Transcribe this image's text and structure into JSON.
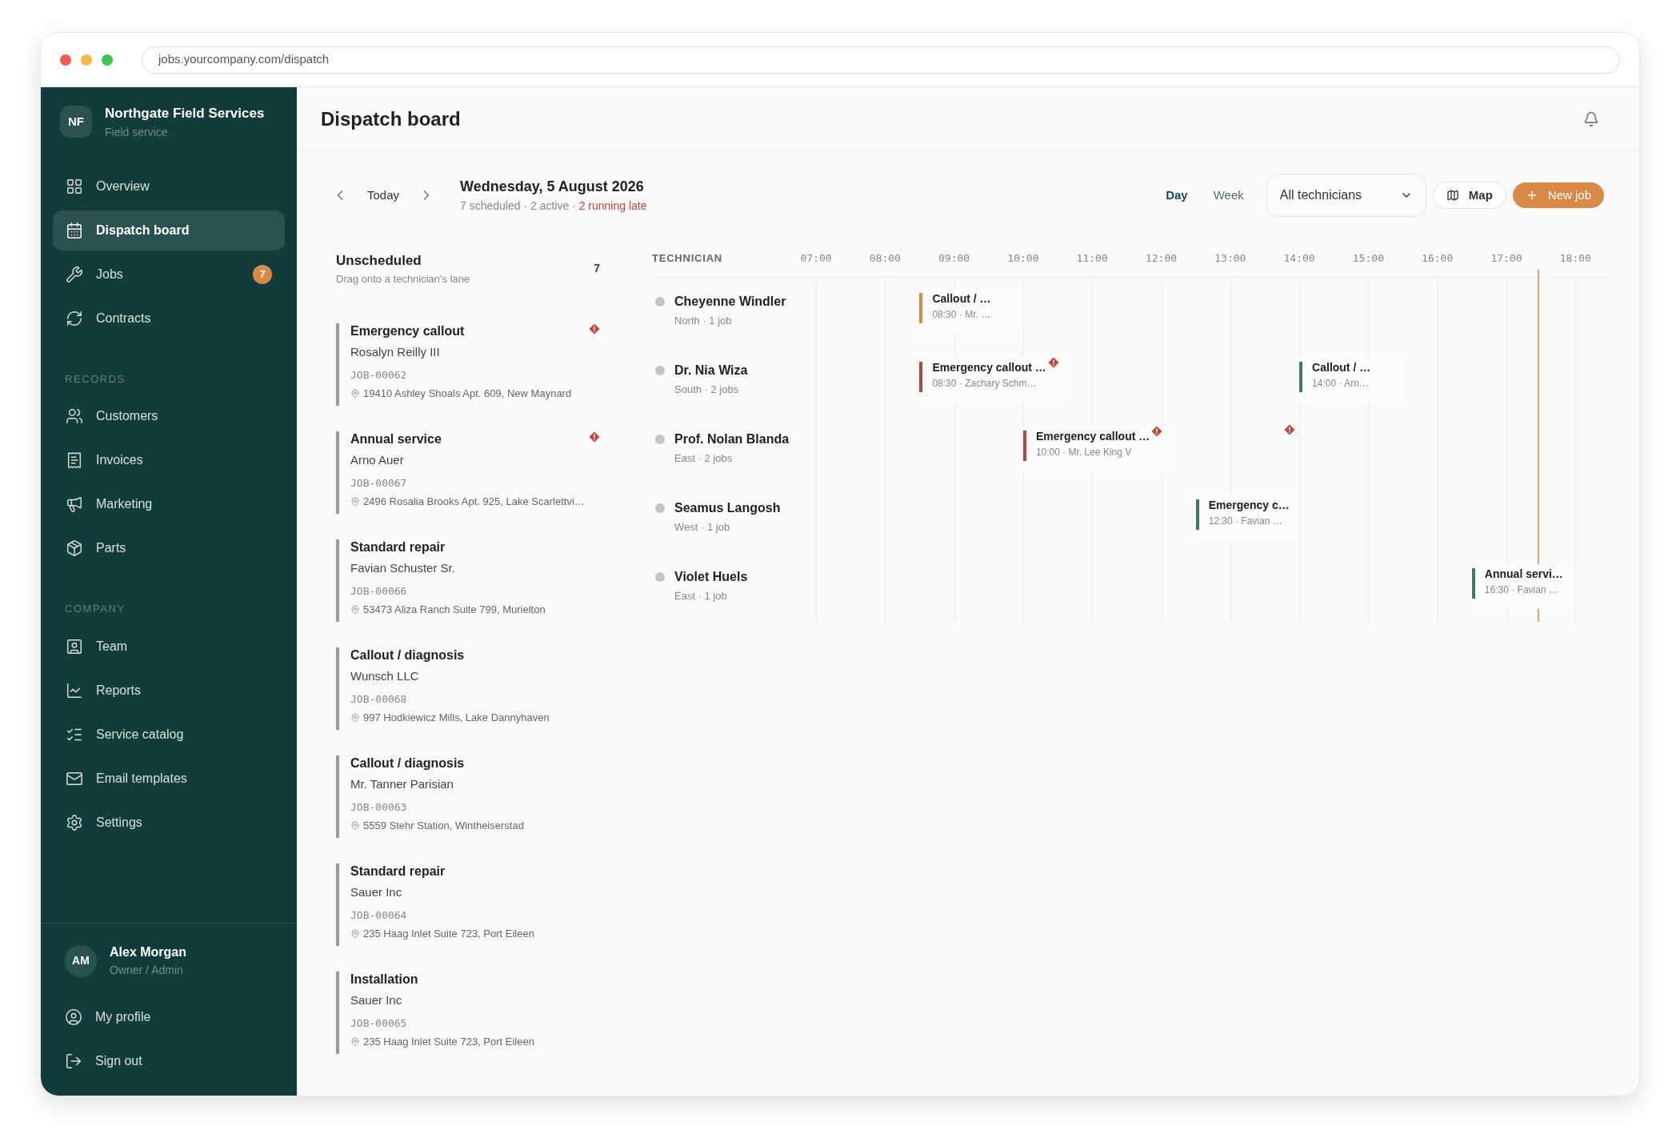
{
  "browser": {
    "url": "jobs.yourcompany.com/dispatch"
  },
  "sidebar": {
    "brand": {
      "initials": "NF",
      "name": "Northgate Field Services",
      "subtitle": "Field service"
    },
    "sections": [
      {
        "items": [
          {
            "label": "Overview",
            "selected": false
          },
          {
            "label": "Dispatch board",
            "selected": true
          },
          {
            "label": "Jobs",
            "selected": false,
            "badge": "7"
          },
          {
            "label": "Contracts",
            "selected": false
          }
        ]
      },
      {
        "heading": "RECORDS",
        "items": [
          {
            "label": "Customers",
            "selected": false
          },
          {
            "label": "Invoices",
            "selected": false
          },
          {
            "label": "Marketing",
            "selected": false
          },
          {
            "label": "Parts",
            "selected": false
          }
        ]
      },
      {
        "heading": "COMPANY",
        "items": [
          {
            "label": "Team",
            "selected": false
          },
          {
            "label": "Reports",
            "selected": false
          },
          {
            "label": "Service catalog",
            "selected": false
          },
          {
            "label": "Email templates",
            "selected": false
          },
          {
            "label": "Settings",
            "selected": false
          }
        ]
      }
    ],
    "user": {
      "initials": "AM",
      "name": "Alex Morgan",
      "role": "Owner / Admin"
    },
    "footer_items": [
      {
        "label": "My profile"
      },
      {
        "label": "Sign out"
      }
    ]
  },
  "header": {
    "title": "Dispatch board"
  },
  "toolbar": {
    "today": "Today",
    "date": "Wednesday, 5 August 2026",
    "summary": "7 scheduled · 2 active · ",
    "late": "2 running late",
    "views": [
      {
        "label": "Day",
        "selected": true
      },
      {
        "label": "Week",
        "selected": false
      }
    ],
    "filter": {
      "value": "All technicians"
    },
    "map": "Map",
    "new_job": "New job"
  },
  "unscheduled": {
    "title": "Unscheduled",
    "hint": "Drag onto a technician's lane",
    "count": "7",
    "jobs": [
      {
        "title": "Emergency callout",
        "customer": "Rosalyn Reilly III",
        "id": "JOB-00062",
        "address": "19410 Ashley Shoals Apt. 609, New Maynard",
        "late": true
      },
      {
        "title": "Annual service",
        "customer": "Arno Auer",
        "id": "JOB-00067",
        "address": "2496 Rosalia Brooks Apt. 925, Lake Scarlettvi…",
        "late": true
      },
      {
        "title": "Standard repair",
        "customer": "Favian Schuster Sr.",
        "id": "JOB-00066",
        "address": "53473 Aliza Ranch Suite 799, Murielton",
        "late": false
      },
      {
        "title": "Callout / diagnosis",
        "customer": "Wunsch LLC",
        "id": "JOB-00068",
        "address": "997 Hodkiewicz Mills, Lake Dannyhaven",
        "late": false
      },
      {
        "title": "Callout / diagnosis",
        "customer": "Mr. Tanner Parisian",
        "id": "JOB-00063",
        "address": "5559 Stehr Station, Wintheiserstad",
        "late": false
      },
      {
        "title": "Standard repair",
        "customer": "Sauer Inc",
        "id": "JOB-00064",
        "address": "235 Haag Inlet Suite 723, Port Eileen",
        "late": false
      },
      {
        "title": "Installation",
        "customer": "Sauer Inc",
        "id": "JOB-00065",
        "address": "235 Haag Inlet Suite 723, Port Eileen",
        "late": false
      }
    ]
  },
  "timeline": {
    "column": "TECHNICIAN",
    "hours": [
      "07:00",
      "08:00",
      "09:00",
      "10:00",
      "11:00",
      "12:00",
      "13:00",
      "14:00",
      "15:00",
      "16:00",
      "17:00",
      "18:00"
    ],
    "now_marker": {
      "level": 0.905
    },
    "lanes": [
      {
        "name": "Cheyenne Windler",
        "meta": "North · 1 job",
        "blocks": [
          {
            "title": "Callout / …",
            "start": "08:30",
            "detail": "· Mr. …",
            "color": "#d98a48",
            "late": false
          }
        ]
      },
      {
        "name": "Dr. Nia Wiza",
        "meta": "South · 2 jobs",
        "blocks": [
          {
            "title": "Emergency callout …",
            "start": "08:30",
            "detail": "· Zachary Schm…",
            "color": "#b8443a",
            "late": true
          },
          {
            "title": "Callout / …",
            "start": "14:00",
            "detail": "· Arn…",
            "color": "#3f7a5f",
            "late": false
          }
        ]
      },
      {
        "name": "Prof. Nolan Blanda",
        "meta": "East · 2 jobs",
        "alerts": [
          {
            "level": 0.594
          }
        ],
        "blocks": [
          {
            "title": "Emergency callout …",
            "start": "10:00",
            "detail": "· Mr. Lee King V",
            "color": "#b8443a",
            "late": true
          }
        ]
      },
      {
        "name": "Seamus Langosh",
        "meta": "West · 1 job",
        "blocks": [
          {
            "title": "Emergency c…",
            "start": "12:30",
            "detail": "· Favian …",
            "color": "#3f7a5f",
            "late": false
          }
        ]
      },
      {
        "name": "Violet Huels",
        "meta": "East · 1 job",
        "blocks": [
          {
            "title": "Annual servi…",
            "start": "16:30",
            "detail": "· Favian …",
            "color": "#3f7a5f",
            "late": false
          }
        ]
      }
    ]
  }
}
